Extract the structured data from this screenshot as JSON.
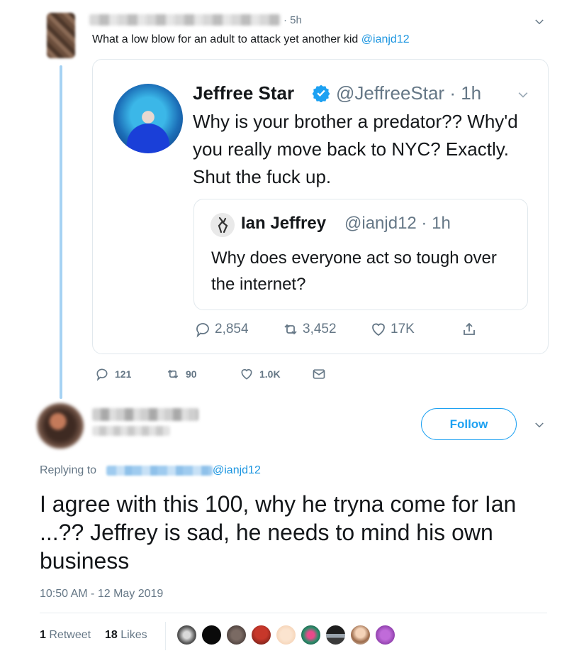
{
  "reply": {
    "time": "· 5h",
    "text": "What a low blow for an adult to attack yet another kid",
    "mention": "@ianjd12"
  },
  "quoted": {
    "name": "Jeffree Star",
    "handle_time": "@JeffreeStar · 1h",
    "text": "Why is your brother a predator?? Why'd you really move back to NYC? Exactly. Shut the fuck up.",
    "inner": {
      "name": "Ian Jeffrey",
      "handle_time": "@ianjd12 · 1h",
      "text": "Why does everyone act so tough over the internet?"
    },
    "actions": {
      "replies": "2,854",
      "retweets": "3,452",
      "likes": "17K"
    }
  },
  "reply_actions": {
    "replies": "121",
    "retweets": "90",
    "likes": "1.0K"
  },
  "main_tweet": {
    "follow_label": "Follow",
    "replying_prefix": "Replying to",
    "replying_mention": "@ianjd12",
    "text": "I agree with this 100, why he tryna come for Ian ...?? Jeffrey is sad, he needs to mind his own business",
    "timestamp": "10:50 AM - 12 May 2019",
    "retweet_count": "1",
    "retweet_label": "Retweet",
    "like_count": "18",
    "like_label": "Likes"
  },
  "colors": {
    "accent": "#1da1f2",
    "muted": "#657786",
    "text": "#14171a",
    "thread": "#a6d2f3"
  },
  "icons": [
    "chevron-down-icon",
    "verified-badge-icon",
    "reply-icon",
    "retweet-icon",
    "heart-icon",
    "share-icon",
    "direct-message-icon"
  ]
}
